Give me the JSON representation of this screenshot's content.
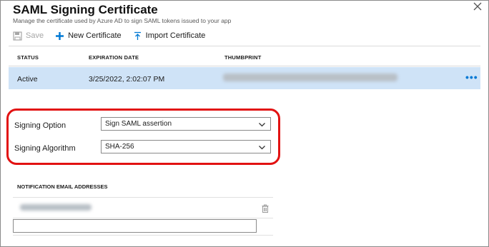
{
  "panel": {
    "title": "SAML Signing Certificate",
    "subtitle": "Manage the certificate used by Azure AD to sign SAML tokens issued to your app"
  },
  "toolbar": {
    "save_label": "Save",
    "new_label": "New Certificate",
    "import_label": "Import Certificate"
  },
  "table": {
    "headers": [
      "STATUS",
      "EXPIRATION DATE",
      "THUMBPRINT"
    ],
    "rows": [
      {
        "status": "Active",
        "expiration": "3/25/2022, 2:02:07 PM",
        "selected": true
      }
    ]
  },
  "signing": {
    "option_label": "Signing Option",
    "option_value": "Sign SAML assertion",
    "algorithm_label": "Signing Algorithm",
    "algorithm_value": "SHA-256"
  },
  "notification": {
    "header": "NOTIFICATION EMAIL ADDRESSES"
  },
  "colors": {
    "accent": "#0078d4",
    "selected_row": "#cfe3f7",
    "highlight": "#e21212"
  },
  "icons": [
    "close-icon",
    "save-icon",
    "plus-icon",
    "upload-icon",
    "more-icon",
    "chevron-down-icon",
    "trash-icon"
  ]
}
